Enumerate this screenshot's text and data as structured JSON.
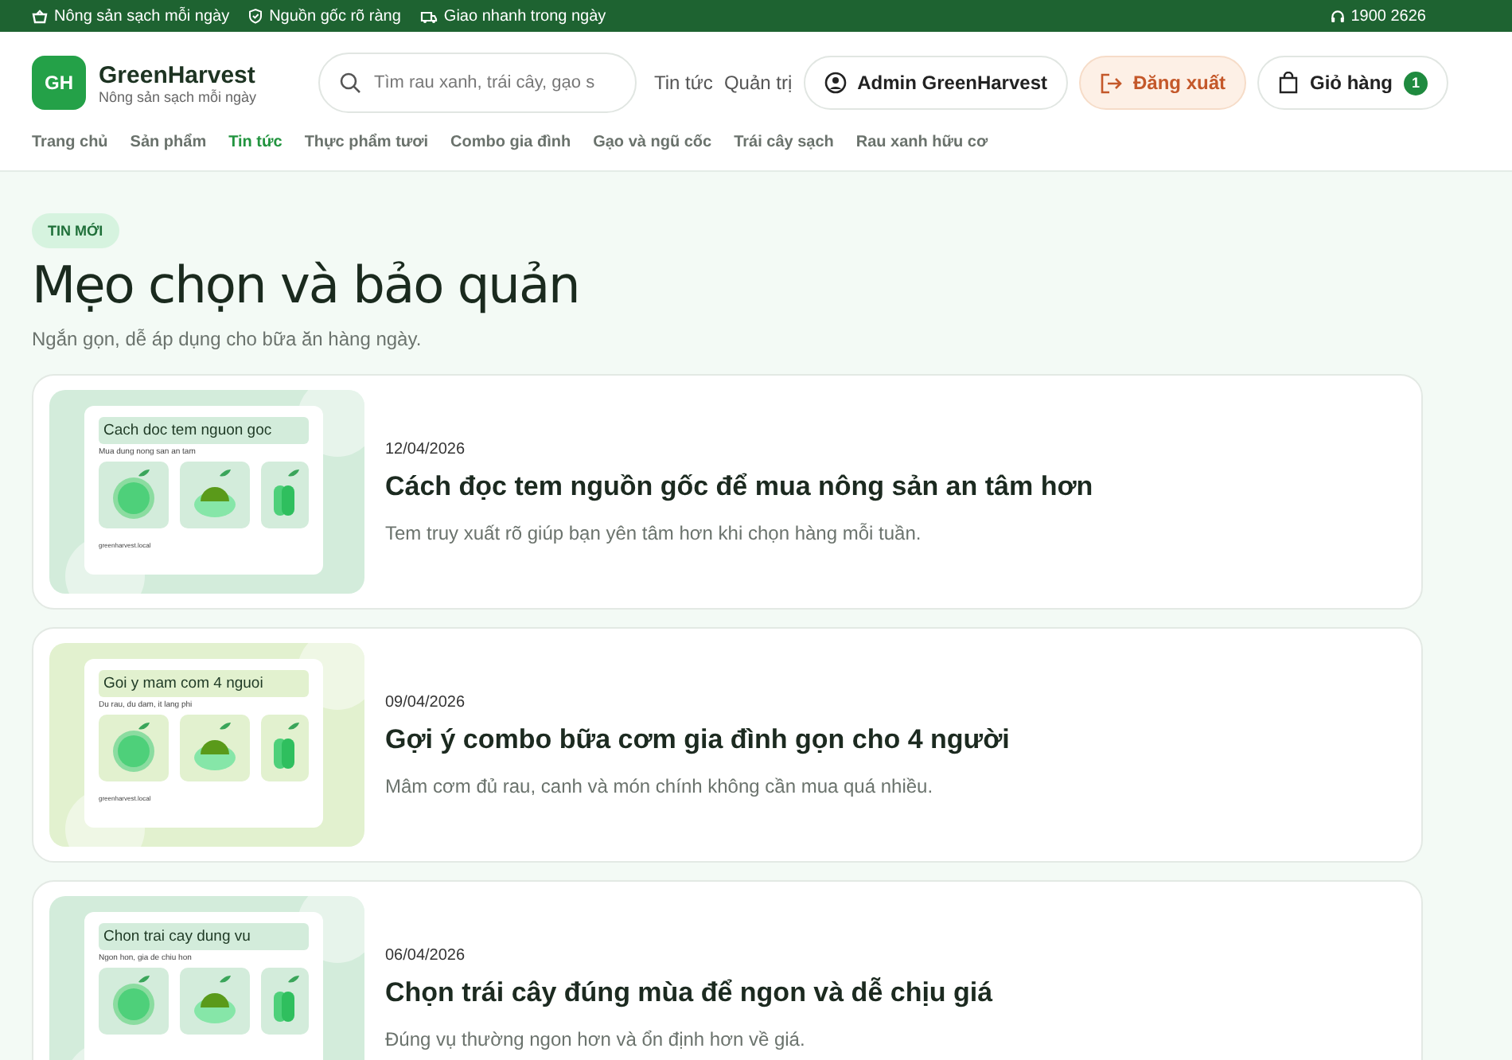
{
  "top_bar": {
    "features": [
      {
        "kind": "basket",
        "label": "Nông sản sạch mỗi ngày"
      },
      {
        "kind": "shield",
        "label": "Nguồn gốc rõ ràng"
      },
      {
        "kind": "truck",
        "label": "Giao nhanh trong ngày"
      }
    ],
    "hotline": "1900 2626"
  },
  "header": {
    "logo": {
      "mark": "GH",
      "name": "GreenHarvest",
      "tagline": "Nông sản sạch mỗi ngày"
    },
    "search": {
      "placeholder": "Tìm rau xanh, trái cây, gạo s"
    },
    "links": [
      "Tin tức",
      "Quản trị"
    ],
    "user": "Admin GreenHarvest",
    "logout": "Đăng xuất",
    "cart": {
      "label": "Giỏ hàng",
      "count": "1"
    },
    "nav": [
      {
        "label": "Trang chủ",
        "selected": false
      },
      {
        "label": "Sản phẩm",
        "selected": false
      },
      {
        "label": "Tin tức",
        "selected": true
      },
      {
        "label": "Thực phẩm tươi",
        "selected": false
      },
      {
        "label": "Combo gia đình",
        "selected": false
      },
      {
        "label": "Gạo và ngũ cốc",
        "selected": false
      },
      {
        "label": "Trái cây sạch",
        "selected": false
      },
      {
        "label": "Rau xanh hữu cơ",
        "selected": false
      }
    ]
  },
  "page": {
    "badge": "TIN MỚI",
    "title": "Mẹo chọn và bảo quản",
    "subtitle": "Ngắn gọn, dễ áp dụng cho bữa ăn hàng ngày."
  },
  "articles": [
    {
      "date": "12/04/2026",
      "title": "Cách đọc tem nguồn gốc để mua nông sản an tâm hơn",
      "summary": "Tem truy xuất rõ giúp bạn yên tâm hơn khi chọn hàng mỗi tuần.",
      "thumbnail": {
        "title": "Cach doc tem nguon goc",
        "subtitle": "Mua dung nong san an tam",
        "footer": "greenharvest.local",
        "color": "#d3ecdb"
      }
    },
    {
      "date": "09/04/2026",
      "title": "Gợi ý combo bữa cơm gia đình gọn cho 4 người",
      "summary": "Mâm cơm đủ rau, canh và món chính không cần mua quá nhiều.",
      "thumbnail": {
        "title": "Goi y mam com 4 nguoi",
        "subtitle": "Du rau, du dam, it lang phi",
        "footer": "greenharvest.local",
        "color": "#e2f1cf"
      }
    },
    {
      "date": "06/04/2026",
      "title": "Chọn trái cây đúng mùa để ngon và dễ chịu giá",
      "summary": "Đúng vụ thường ngon hơn và ổn định hơn về giá.",
      "thumbnail": {
        "title": "Chon trai cay dung vu",
        "subtitle": "Ngon hon, gia de chiu hon",
        "color": "#d3ecdb"
      }
    }
  ]
}
